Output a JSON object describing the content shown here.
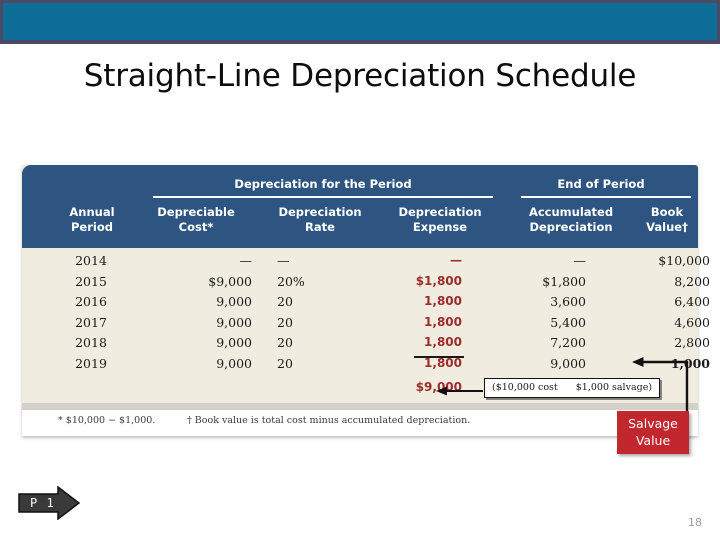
{
  "slide": {
    "title": "Straight-Line Depreciation Schedule",
    "page_number": "18",
    "reference_tag": "P 1",
    "accent_band_color": "#0E6E99",
    "band_frame_color": "#4A4A63",
    "table_header_color": "#2E5581",
    "table_body_color": "#F0EDE0",
    "highlight_color": "#9E2B2B",
    "callout_color": "#C1272D"
  },
  "table": {
    "group_headers": [
      {
        "label": "Depreciation for the Period"
      },
      {
        "label": "End of Period"
      }
    ],
    "columns": [
      {
        "line1": "Annual",
        "line2": "Period"
      },
      {
        "line1": "Depreciable",
        "line2": "Cost*"
      },
      {
        "line1": "Depreciation",
        "line2": "Rate"
      },
      {
        "line1": "Depreciation",
        "line2": "Expense"
      },
      {
        "line1": "Accumulated",
        "line2": "Depreciation"
      },
      {
        "line1": "Book",
        "line2": "Value†"
      }
    ],
    "rows": [
      {
        "period": "2014",
        "depreciable_cost": "—",
        "rate": "—",
        "expense": "—",
        "accumulated": "—",
        "book_value": "$10,000"
      },
      {
        "period": "2015",
        "depreciable_cost": "$9,000",
        "rate": "20%",
        "expense": "$1,800",
        "accumulated": "$1,800",
        "book_value": "8,200"
      },
      {
        "period": "2016",
        "depreciable_cost": "9,000",
        "rate": "20",
        "expense": "1,800",
        "accumulated": "3,600",
        "book_value": "6,400"
      },
      {
        "period": "2017",
        "depreciable_cost": "9,000",
        "rate": "20",
        "expense": "1,800",
        "accumulated": "5,400",
        "book_value": "4,600"
      },
      {
        "period": "2018",
        "depreciable_cost": "9,000",
        "rate": "20",
        "expense": "1,800",
        "accumulated": "7,200",
        "book_value": "2,800"
      },
      {
        "period": "2019",
        "depreciable_cost": "9,000",
        "rate": "20",
        "expense": "1,800",
        "accumulated": "9,000",
        "book_value": "1,000"
      }
    ],
    "total_expense": "$9,000",
    "footnotes": {
      "asterisk": "* $10,000 − $1,000.",
      "dagger": "† Book value is total cost minus accumulated depreciation."
    }
  },
  "annotations": {
    "cost_callout_left": "($10,000 cost",
    "cost_callout_right": "$1,000 salvage)",
    "salvage_label_line1": "Salvage",
    "salvage_label_line2": "Value"
  }
}
